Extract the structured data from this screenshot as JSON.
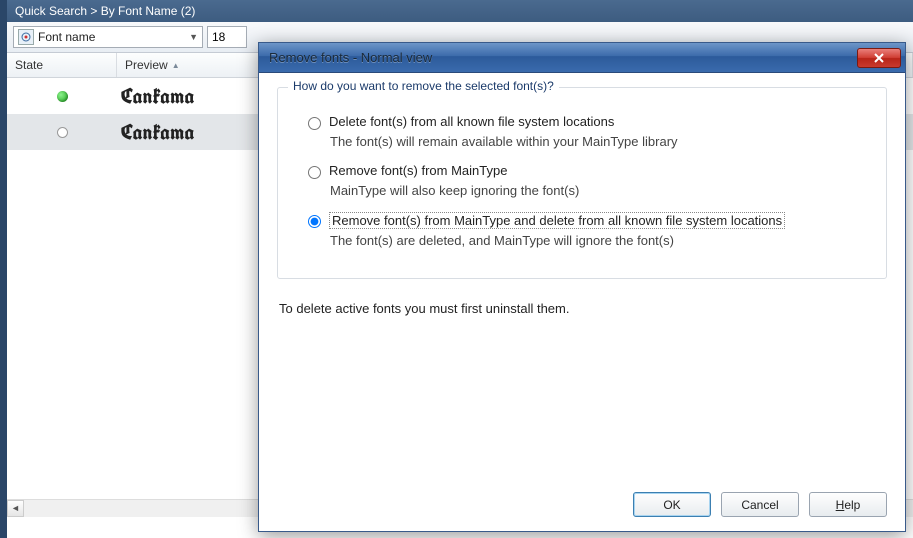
{
  "panel": {
    "title": "Quick Search > By Font Name (2)"
  },
  "toolbar": {
    "font_field_label": "Font name",
    "size_value": "18"
  },
  "columns": {
    "state": "State",
    "preview": "Preview"
  },
  "rows": [
    {
      "state": "active",
      "preview": "Cankama"
    },
    {
      "state": "inactive",
      "preview": "Cankama"
    }
  ],
  "dialog": {
    "title": "Remove fonts - Normal view",
    "group_title": "How do you want to remove the selected font(s)?",
    "options": [
      {
        "label": "Delete font(s) from all known file system locations",
        "desc": "The font(s) will remain available within your MainType library"
      },
      {
        "label": "Remove font(s) from MainType",
        "desc": "MainType will also keep ignoring the font(s)"
      },
      {
        "label": "Remove font(s) from MainType and delete from all known file system locations",
        "desc": "The font(s) are deleted, and MainType will ignore the font(s)"
      }
    ],
    "selected_option": 2,
    "note": "To delete active fonts you must first uninstall them.",
    "buttons": {
      "ok": "OK",
      "cancel": "Cancel",
      "help_pre": "H",
      "help_post": "elp"
    }
  }
}
